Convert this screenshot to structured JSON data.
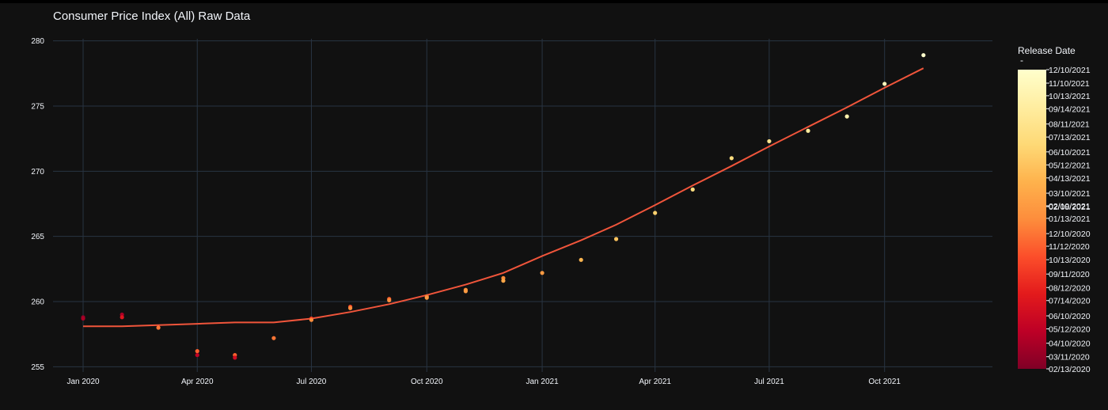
{
  "chart_data": {
    "type": "scatter",
    "title": "Consumer Price Index (All) Raw Data",
    "xlabel": "",
    "ylabel": "",
    "ylim": [
      254.6,
      280.4
    ],
    "xlim": [
      "2019-12-08",
      "2021-12-26"
    ],
    "grid": true,
    "x_ticks": [
      {
        "date": "2020-01-01",
        "label": "Jan 2020"
      },
      {
        "date": "2020-04-01",
        "label": "Apr 2020"
      },
      {
        "date": "2020-07-01",
        "label": "Jul 2020"
      },
      {
        "date": "2020-10-01",
        "label": "Oct 2020"
      },
      {
        "date": "2021-01-01",
        "label": "Jan 2021"
      },
      {
        "date": "2021-04-01",
        "label": "Apr 2021"
      },
      {
        "date": "2021-07-01",
        "label": "Jul 2021"
      },
      {
        "date": "2021-10-01",
        "label": "Oct 2021"
      }
    ],
    "y_ticks": [
      255,
      260,
      265,
      270,
      275,
      280
    ],
    "points": [
      {
        "x": "2020-01-01",
        "y": 258.8,
        "release": "03/11/2020"
      },
      {
        "x": "2020-01-01",
        "y": 258.7,
        "release": "04/10/2020"
      },
      {
        "x": "2020-02-01",
        "y": 259.0,
        "release": "04/10/2020"
      },
      {
        "x": "2020-02-01",
        "y": 258.8,
        "release": "07/14/2020"
      },
      {
        "x": "2020-03-01",
        "y": 258.0,
        "release": "12/10/2020"
      },
      {
        "x": "2020-04-01",
        "y": 256.2,
        "release": "11/12/2020"
      },
      {
        "x": "2020-04-01",
        "y": 255.9,
        "release": "05/12/2020"
      },
      {
        "x": "2020-05-01",
        "y": 255.9,
        "release": "11/12/2020"
      },
      {
        "x": "2020-05-01",
        "y": 255.7,
        "release": "06/10/2020"
      },
      {
        "x": "2020-06-01",
        "y": 257.2,
        "release": "12/10/2020"
      },
      {
        "x": "2020-07-01",
        "y": 258.7,
        "release": "09/11/2020"
      },
      {
        "x": "2020-07-01",
        "y": 258.6,
        "release": "01/13/2021"
      },
      {
        "x": "2020-08-01",
        "y": 259.6,
        "release": "10/13/2020"
      },
      {
        "x": "2020-08-01",
        "y": 259.5,
        "release": "01/13/2021"
      },
      {
        "x": "2020-09-01",
        "y": 260.2,
        "release": "11/12/2020"
      },
      {
        "x": "2020-09-01",
        "y": 260.1,
        "release": "01/13/2021"
      },
      {
        "x": "2020-10-01",
        "y": 260.4,
        "release": "12/10/2020"
      },
      {
        "x": "2020-10-01",
        "y": 260.3,
        "release": "02/10/2021"
      },
      {
        "x": "2020-11-01",
        "y": 260.9,
        "release": "01/13/2021"
      },
      {
        "x": "2020-11-01",
        "y": 260.8,
        "release": "02/10/2021"
      },
      {
        "x": "2020-12-01",
        "y": 261.8,
        "release": "01/13/2021"
      },
      {
        "x": "2020-12-01",
        "y": 261.6,
        "release": "03/10/2021"
      },
      {
        "x": "2021-01-01",
        "y": 262.2,
        "release": "02/10/2021"
      },
      {
        "x": "2021-02-01",
        "y": 263.2,
        "release": "04/13/2021"
      },
      {
        "x": "2021-03-01",
        "y": 264.8,
        "release": "05/12/2021"
      },
      {
        "x": "2021-04-01",
        "y": 266.8,
        "release": "06/10/2021"
      },
      {
        "x": "2021-05-01",
        "y": 268.6,
        "release": "07/13/2021"
      },
      {
        "x": "2021-06-01",
        "y": 271.0,
        "release": "07/13/2021"
      },
      {
        "x": "2021-07-01",
        "y": 272.3,
        "release": "08/11/2021"
      },
      {
        "x": "2021-08-01",
        "y": 273.1,
        "release": "09/14/2021"
      },
      {
        "x": "2021-09-01",
        "y": 274.2,
        "release": "10/13/2021"
      },
      {
        "x": "2021-10-01",
        "y": 276.7,
        "release": "11/10/2021"
      },
      {
        "x": "2021-11-01",
        "y": 278.9,
        "release": "12/10/2021"
      }
    ],
    "trend_line": {
      "color": "#f0553b",
      "x": [
        "2020-01-01",
        "2020-02-01",
        "2020-03-01",
        "2020-04-01",
        "2020-05-01",
        "2020-06-01",
        "2020-07-01",
        "2020-08-01",
        "2020-09-01",
        "2020-10-01",
        "2020-11-01",
        "2020-12-01",
        "2021-01-01",
        "2021-02-01",
        "2021-03-01",
        "2021-04-01",
        "2021-05-01",
        "2021-06-01",
        "2021-07-01",
        "2021-08-01",
        "2021-09-01",
        "2021-10-01",
        "2021-11-01"
      ],
      "y": [
        258.1,
        258.1,
        258.2,
        258.3,
        258.4,
        258.4,
        258.7,
        259.2,
        259.8,
        260.5,
        261.3,
        262.2,
        263.5,
        264.7,
        265.9,
        267.4,
        268.9,
        270.4,
        271.9,
        273.4,
        274.9,
        276.4,
        277.9
      ]
    },
    "colorbar": {
      "title": "Release Date",
      "subtitle": "-",
      "ticks": [
        {
          "date": "2020-02-13",
          "label": "02/13/2020"
        },
        {
          "date": "2020-03-11",
          "label": "03/11/2020"
        },
        {
          "date": "2020-04-10",
          "label": "04/10/2020"
        },
        {
          "date": "2020-05-12",
          "label": "05/12/2020"
        },
        {
          "date": "2020-06-10",
          "label": "06/10/2020"
        },
        {
          "date": "2020-07-14",
          "label": "07/14/2020"
        },
        {
          "date": "2020-08-12",
          "label": "08/12/2020"
        },
        {
          "date": "2020-09-11",
          "label": "09/11/2020"
        },
        {
          "date": "2020-10-13",
          "label": "10/13/2020"
        },
        {
          "date": "2020-11-12",
          "label": "11/12/2020"
        },
        {
          "date": "2020-12-10",
          "label": "12/10/2020"
        },
        {
          "date": "2021-01-13",
          "label": "01/13/2021"
        },
        {
          "date": "2021-02-08",
          "label": "02/08/2021"
        },
        {
          "date": "2021-02-10",
          "label": "02/10/2021"
        },
        {
          "date": "2021-03-10",
          "label": "03/10/2021"
        },
        {
          "date": "2021-04-13",
          "label": "04/13/2021"
        },
        {
          "date": "2021-05-12",
          "label": "05/12/2021"
        },
        {
          "date": "2021-06-10",
          "label": "06/10/2021"
        },
        {
          "date": "2021-07-13",
          "label": "07/13/2021"
        },
        {
          "date": "2021-08-11",
          "label": "08/11/2021"
        },
        {
          "date": "2021-09-14",
          "label": "09/14/2021"
        },
        {
          "date": "2021-10-13",
          "label": "10/13/2021"
        },
        {
          "date": "2021-11-10",
          "label": "11/10/2021"
        },
        {
          "date": "2021-12-10",
          "label": "12/10/2021"
        }
      ],
      "colorscale": [
        "#800026",
        "#bd0026",
        "#e31a1c",
        "#fc4e2a",
        "#fd8d3c",
        "#feb24c",
        "#fed976",
        "#ffeda0",
        "#ffffcc"
      ]
    },
    "colors": {
      "background": "#111111",
      "grid": "#283442",
      "text": "#f2f5fa"
    }
  }
}
